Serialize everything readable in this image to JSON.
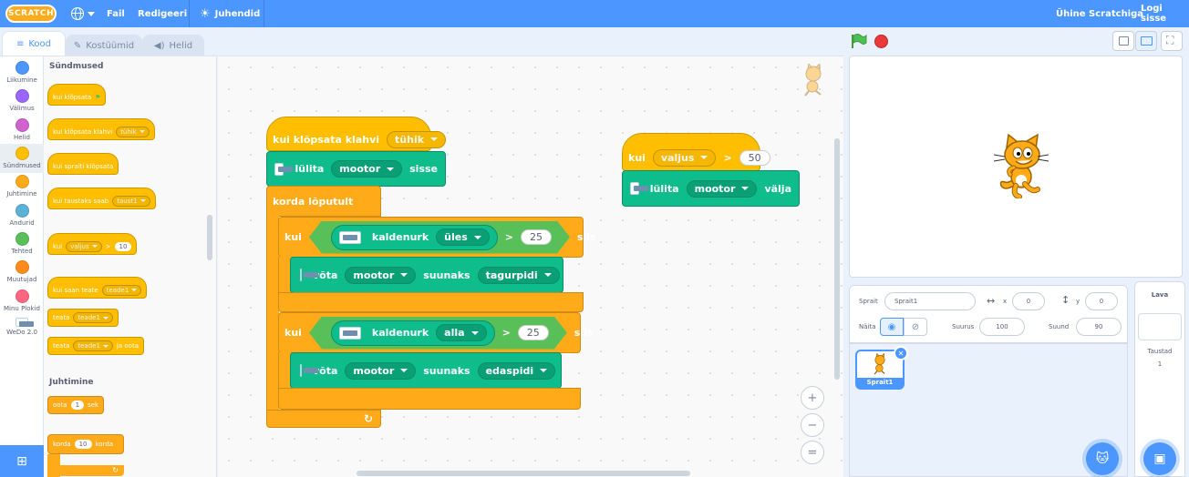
{
  "menu": {
    "logo": "SCRATCH",
    "file": "Fail",
    "edit": "Redigeeri",
    "tutorials": "Juhendid",
    "join": "Ühine Scratchiga",
    "signin": "Logi sisse"
  },
  "tabs": {
    "code": "Kood",
    "costumes": "Kostüümid",
    "sounds": "Helid"
  },
  "categories": [
    {
      "label": "Liikumine",
      "color": "#4c97ff"
    },
    {
      "label": "Välimus",
      "color": "#9966ff"
    },
    {
      "label": "Helid",
      "color": "#cf63cf"
    },
    {
      "label": "Sündmused",
      "color": "#ffbf00"
    },
    {
      "label": "Juhtimine",
      "color": "#ffab19"
    },
    {
      "label": "Andurid",
      "color": "#5cb1d6"
    },
    {
      "label": "Tehted",
      "color": "#59c059"
    },
    {
      "label": "Muutujad",
      "color": "#ff8c1a"
    },
    {
      "label": "Minu Plokid",
      "color": "#ff6680"
    },
    {
      "label": "WeDo 2.0",
      "color": "#e9eef2"
    }
  ],
  "palette": {
    "events_heading": "Sündmused",
    "control_heading": "Juhtimine",
    "when_flag": "kui klõpsata",
    "when_key": "kui klõpsata klahvi",
    "key_value": "tühik",
    "when_sprite": "kui spraiti klõpsata",
    "when_backdrop": "kui taustaks saab",
    "backdrop_value": "taust1",
    "when_gt_kui": "kui",
    "loudness": "valjus",
    "gt": ">",
    "gt_value": "10",
    "when_receive": "kui saan teate",
    "message1": "teade1",
    "broadcast": "teata",
    "broadcast_wait_suffix": "ja oota",
    "wait": "oota",
    "wait_value": "1",
    "wait_unit": "sek",
    "repeat": "korda",
    "repeat_value": "10",
    "repeat_suffix": "korda"
  },
  "script1": {
    "hat": "kui klõpsata klahvi",
    "hat_key": "tühik",
    "motor_on": "lülita",
    "motor": "mootor",
    "motor_on_suffix": "sisse",
    "forever": "korda lõputult",
    "if1": "kui",
    "tilt": "kaldenurk",
    "dir_up": "üles",
    "gt": ">",
    "v1": "25",
    "then1": "siis",
    "set_dir": "võta",
    "towards": "suunaks",
    "reverse": "tagurpidi",
    "if2": "kui",
    "dir_down": "alla",
    "v2": "25",
    "then2": "siis",
    "forward": "edaspidi"
  },
  "script2": {
    "kui": "kui",
    "sensor": "valjus",
    "gt": ">",
    "value": "50",
    "motor_off": "lülita",
    "motor": "mootor",
    "off_suffix": "välja"
  },
  "zoom": {
    "in": "+",
    "out": "−",
    "reset": "="
  },
  "sprite_info": {
    "sprite_label": "Sprait",
    "sprite_name": "Sprait1",
    "x_label": "x",
    "x": "0",
    "y_label": "y",
    "y": "0",
    "show_label": "Näita",
    "size_label": "Suurus",
    "size": "100",
    "direction_label": "Suund",
    "direction": "90"
  },
  "sprite_list": [
    {
      "name": "Sprait1"
    }
  ],
  "stage_panel": {
    "title": "Lava",
    "backdrops_label": "Taustad",
    "backdrop_count": "1"
  }
}
